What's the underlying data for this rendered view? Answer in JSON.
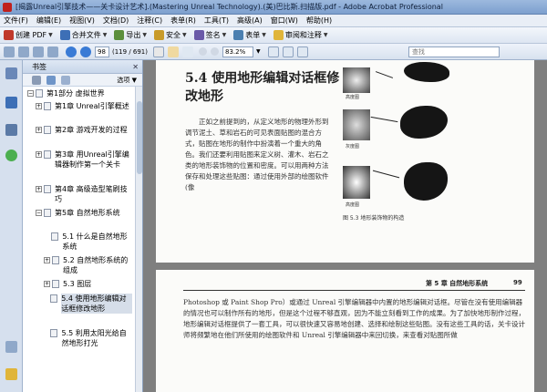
{
  "window": {
    "title": "[揭露Unreal引擎技术——关卡设计艺术].(Mastering Unreal Technology).(美)巴比斯.扫描版.pdf - Adobe Acrobat Professional"
  },
  "menu": [
    "文件(F)",
    "编辑(E)",
    "视图(V)",
    "文档(D)",
    "注释(C)",
    "表单(R)",
    "工具(T)",
    "高级(A)",
    "窗口(W)",
    "帮助(H)"
  ],
  "toolbar1": {
    "create_pdf": "创建 PDF",
    "merge_files": "合并文件",
    "export": "导出",
    "secure": "安全",
    "sign": "签名",
    "forms": "表单",
    "review_comment": "审阅和注释"
  },
  "toolbar2": {
    "page_number": "98",
    "page_of": "(119 / 691)",
    "zoom": "83.2%",
    "search_placeholder": "查找"
  },
  "bookmarks_panel": {
    "title": "书签",
    "options": "选项",
    "items": [
      {
        "text": "第1部分  虚拟世界"
      },
      {
        "text": "第1章  Unreal引擎概述"
      },
      {
        "text": "第2章  游戏开发的过程"
      },
      {
        "text": "第3章  用Unreal引擎编辑器制作第一个关卡"
      },
      {
        "text": "第4章  高级造型笔刷技巧"
      },
      {
        "text": "第5章  自然地形系统"
      },
      {
        "text": "5.1  什么是自然地形系统"
      },
      {
        "text": "5.2  自然地形系统的组成"
      },
      {
        "text": "5.3  图层"
      },
      {
        "text": "5.4  使用地形编辑对话框修改地形"
      },
      {
        "text": "5.5  利用太阳光给自然地形打光"
      }
    ]
  },
  "document": {
    "heading": "5.4  使用地形编辑对话框修改地形",
    "paragraph": "正如之前提到的，从定义地形的物理外形到调节泥土、草和岩石的可见表面贴图的混合方式，贴图在地形的制作中扮演着一个重大的角色。我们还要利用贴图来定义树、灌木、岩石之类的地形装饰物的位置和密度。可以用两种方法保存和处理这些贴图：通过使用外部的绘图软件(像",
    "figure_labels": [
      "高度图",
      "灰度图",
      "高度图"
    ],
    "figure_caption": "图 5.3    地形装饰物的构造",
    "page2_running_head": "第 5 章    自然地形系统",
    "page2_number": "99",
    "page2_paragraph": "Photoshop 或 Paint Shop Pro）或通过 Unreal 引擎编辑器中内置的地形编辑对话框。尽管在没有使用编辑器的情况也可以制作所有的地形，但是这个过程不够直观，因为不能立刻看到工作的成果。为了加快地形制作过程，地形编辑对话框提供了一套工具，可以很快速又容易地创建、选择和绘制这些贴图。没有这些工具的话，关卡设计师将频繁地在他们所使用的绘图软件和 Unreal 引擎编辑器中来回切换，来查看对贴图所做"
  }
}
